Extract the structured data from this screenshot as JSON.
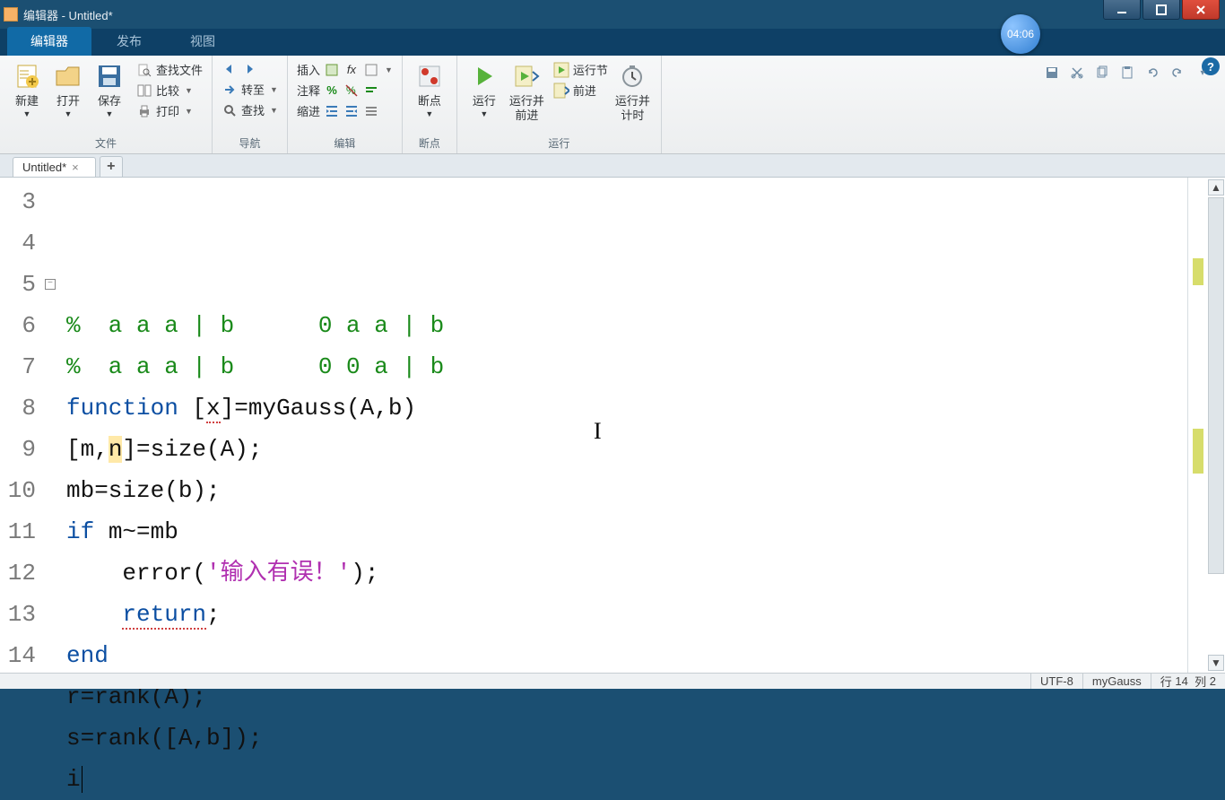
{
  "window": {
    "title": "编辑器 - Untitled*",
    "time_overlay": "04:06"
  },
  "ribbon": {
    "tabs": {
      "editor": "编辑器",
      "publish": "发布",
      "view": "视图"
    },
    "file": {
      "new": "新建",
      "open": "打开",
      "save": "保存",
      "findfiles": "查找文件",
      "compare": "比较",
      "print": "打印",
      "group": "文件"
    },
    "nav": {
      "goto": "转至",
      "find": "查找",
      "group": "导航"
    },
    "edit": {
      "insert": "插入",
      "comment": "注释",
      "indent": "缩进",
      "fx": "fx",
      "group": "编辑"
    },
    "bp": {
      "break": "断点",
      "group": "断点"
    },
    "run": {
      "run": "运行",
      "run_advance": "运行并\n前进",
      "run_section": "运行节",
      "advance": "前进",
      "run_time": "运行并\n计时",
      "group": "运行"
    }
  },
  "doc": {
    "tab_name": "Untitled*"
  },
  "code": {
    "lines": [
      {
        "n": "3",
        "html": "<span class='comment'>%  a a a | b      0 a a | b</span>"
      },
      {
        "n": "4",
        "html": "<span class='comment'>%  a a a | b      0 0 a | b</span>"
      },
      {
        "n": "5",
        "html": "<span class='kw'>function</span> [<span class='underline-dotted'>x</span>]=myGauss(A,b)",
        "fold": true
      },
      {
        "n": "6",
        "html": "[m,<span class='hl-n'>n</span>]=size(A);"
      },
      {
        "n": "7",
        "html": "mb=size(b);"
      },
      {
        "n": "8",
        "html": "<span class='kw'>if</span> m~=mb"
      },
      {
        "n": "9",
        "html": "    error(<span class='str'>'输入有误！'</span>);"
      },
      {
        "n": "10",
        "html": "    <span class='underline-dotted kw'>return</span>;"
      },
      {
        "n": "11",
        "html": "<span class='kw'>end</span>"
      },
      {
        "n": "12",
        "html": "r=rank(A);"
      },
      {
        "n": "13",
        "html": "s=rank([A,b]);"
      },
      {
        "n": "14",
        "html": "i<span class='cursor'></span>"
      }
    ]
  },
  "status": {
    "encoding": "UTF-8",
    "func": "myGauss",
    "line_label": "行",
    "line_val": "14",
    "col_label": "列",
    "col_val": "2"
  }
}
